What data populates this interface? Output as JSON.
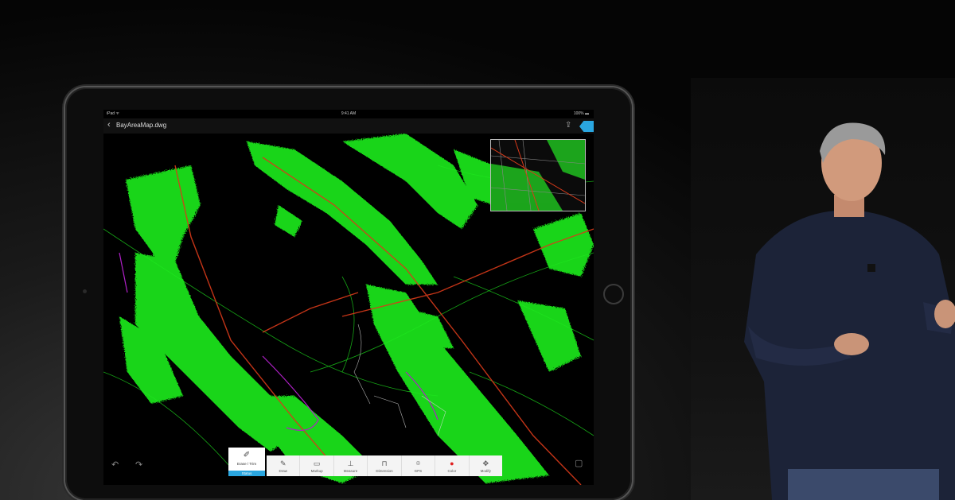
{
  "status_bar": {
    "carrier": "iPad ᯤ",
    "time": "9:41 AM",
    "battery": "100% ▬"
  },
  "nav_bar": {
    "back_icon": "chevron-left-icon",
    "document_title": "BayAreaMap.dwg",
    "share_icon": "share-icon"
  },
  "toolbar": {
    "active_tool": {
      "label": "Erase / Trim",
      "status": "Status",
      "icon": "erase-icon"
    },
    "tools": [
      {
        "label": "Draw",
        "icon": "draw-icon",
        "glyph": "✎"
      },
      {
        "label": "Markup",
        "icon": "markup-icon",
        "glyph": "▭"
      },
      {
        "label": "Measure",
        "icon": "measure-icon",
        "glyph": "⊥"
      },
      {
        "label": "Dimension",
        "icon": "dimension-icon",
        "glyph": "⊓"
      },
      {
        "label": "GPS",
        "icon": "gps-pin-icon",
        "glyph": "⌾"
      },
      {
        "label": "Color",
        "icon": "color-dot-icon",
        "glyph": "●"
      },
      {
        "label": "Modify",
        "icon": "move-icon",
        "glyph": "✥"
      }
    ]
  },
  "colors": {
    "map_green": "#1fe81f",
    "road_red": "#d83a1a",
    "accent_blue": "#2aa6e0",
    "boundary_magenta": "#b020c8"
  }
}
